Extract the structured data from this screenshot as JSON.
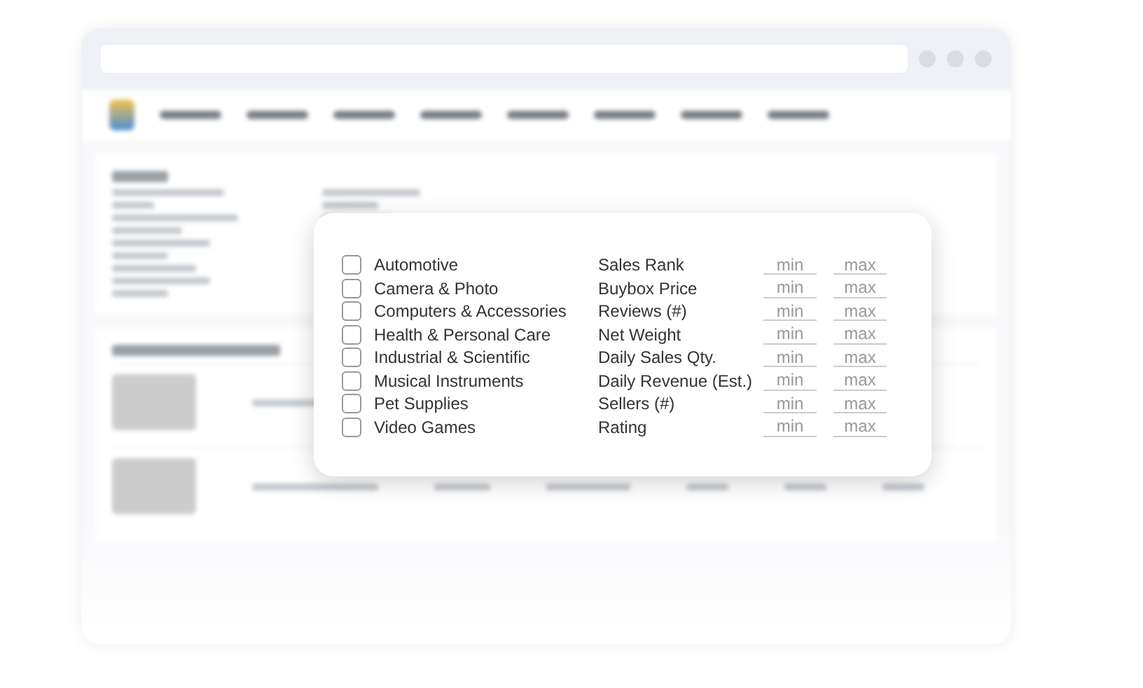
{
  "filter_card": {
    "categories": [
      {
        "label": "Automotive",
        "checked": false
      },
      {
        "label": "Camera & Photo",
        "checked": false
      },
      {
        "label": "Computers & Accessories",
        "checked": false
      },
      {
        "label": "Health & Personal Care",
        "checked": false
      },
      {
        "label": "Industrial & Scientific",
        "checked": false
      },
      {
        "label": "Musical Instruments",
        "checked": false
      },
      {
        "label": "Pet Supplies",
        "checked": false
      },
      {
        "label": "Video Games",
        "checked": false
      }
    ],
    "ranges": [
      {
        "label": "Sales Rank",
        "min_placeholder": "min",
        "max_placeholder": "max"
      },
      {
        "label": "Buybox Price",
        "min_placeholder": "min",
        "max_placeholder": "max"
      },
      {
        "label": "Reviews (#)",
        "min_placeholder": "min",
        "max_placeholder": "max"
      },
      {
        "label": "Net Weight",
        "min_placeholder": "min",
        "max_placeholder": "max"
      },
      {
        "label": "Daily Sales Qty.",
        "min_placeholder": "min",
        "max_placeholder": "max"
      },
      {
        "label": "Daily Revenue (Est.)",
        "min_placeholder": "min",
        "max_placeholder": "max"
      },
      {
        "label": "Sellers (#)",
        "min_placeholder": "min",
        "max_placeholder": "max"
      },
      {
        "label": "Rating",
        "min_placeholder": "min",
        "max_placeholder": "max"
      }
    ]
  }
}
